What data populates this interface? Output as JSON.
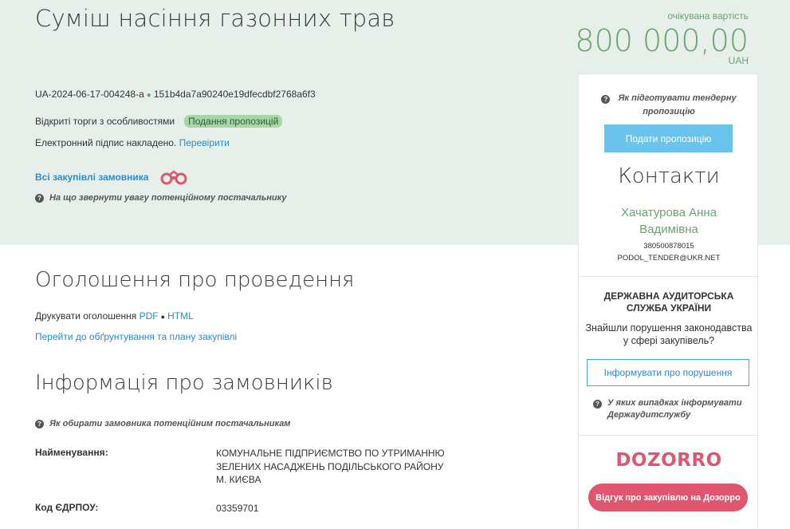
{
  "header": {
    "title": "Суміш насіння газонних трав",
    "value_label": "очікувана вартість",
    "value_amount": "800 000,00",
    "currency": "UAH",
    "tender_id": "UA-2024-06-17-004248-a",
    "tender_hash": "151b4da7a90240e19dfecdbf2768a6f3",
    "procedure_type": "Відкриті торги з особливостями",
    "status_badge": "Подання пропозицій",
    "signature_text": "Електронний підпис накладено.",
    "signature_link": "Перевірити",
    "all_purchases_link": "Всі закупівлі замовника",
    "supplier_hint": "На що звернути увагу потенційному постачальнику"
  },
  "announcement": {
    "title": "Оголошення про проведення",
    "print_label": "Друкувати оголошення",
    "pdf_link": "PDF",
    "html_link": "HTML",
    "plan_link": "Перейти до обґрунтування та плану закупівлі"
  },
  "customer": {
    "title": "Інформація про замовників",
    "hint": "Як обирати замовника потенційним постачальникам",
    "name_label": "Найменування:",
    "name_value": "КОМУНАЛЬНЕ ПІДПРИЄМСТВО ПО УТРИМАННЮ ЗЕЛЕНИХ НАСАДЖЕНЬ ПОДІЛЬСЬКОГО РАЙОНУ М. КИЄВА",
    "edrpou_label": "Код ЄДРПОУ:",
    "edrpou_value": "03359701"
  },
  "sidebar": {
    "prepare_hint": "Як підготувати тендерну пропозицію",
    "submit_button": "Подати пропозицію",
    "contacts_title": "Контакти",
    "contact_name": "Хачатурова Анна Вадимівна",
    "contact_phone": "380500878015",
    "contact_email": "PODOL_TENDER@UKR.NET",
    "audit_title": "ДЕРЖАВНА АУДИТОРСЬКА СЛУЖБА УКРАЇНИ",
    "audit_text": "Знайшли порушення законодавства у сфері закупівель?",
    "report_button": "Інформувати про порушення",
    "audit_hint": "У яких випадках інформувати Держаудитслужбу",
    "dozorro_logo": "DOZORRO",
    "dozorro_button": "Відгук про закупівлю на Дозорро"
  },
  "colors": {
    "accent_green": "#6aa46d",
    "link_blue": "#2e8bc9",
    "submit_blue": "#69c3ea",
    "dozorro_red": "#e0566e",
    "band_bg": "#e7efea"
  },
  "icons": [
    "help-circle-icon",
    "binoculars-icon"
  ]
}
